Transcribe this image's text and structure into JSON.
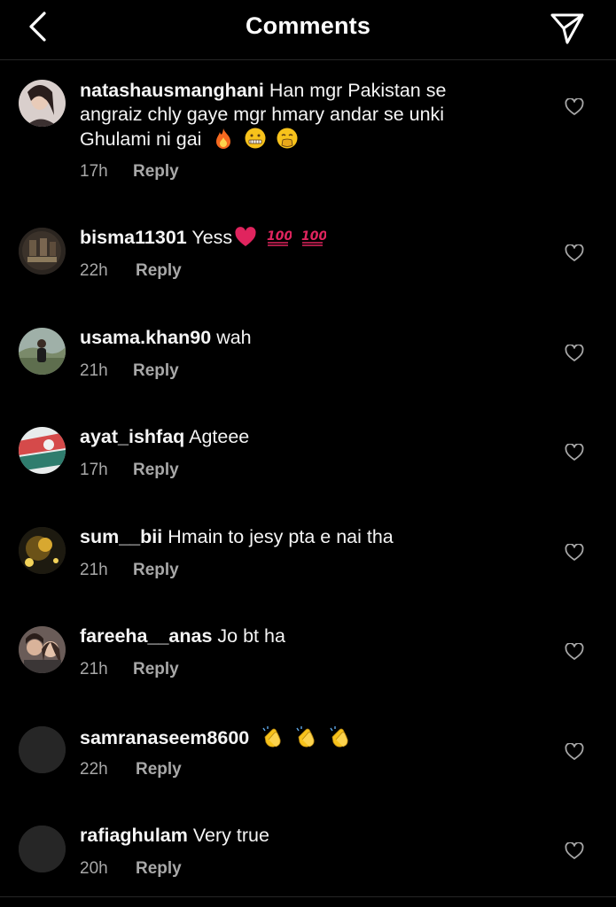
{
  "header": {
    "title": "Comments",
    "back_icon": "chevron-left-icon",
    "share_icon": "paper-plane-icon"
  },
  "colors": {
    "background": "#000000",
    "text": "#f5f5f5",
    "muted": "#a8a8a8",
    "divider": "#262626",
    "heart_red": "#e0245e",
    "hundred_red": "#e0245e",
    "fire_orange": "#f5691f",
    "emoji_yellow": "#f7c21b"
  },
  "comments": [
    {
      "username": "natashausmanghani",
      "text_lines": [
        "Han mgr Pakistan se",
        "angraiz chly gaye mgr hmary andar se unki",
        "Ghulami ni gai"
      ],
      "emojis": [
        "fire",
        "zipper-mouth-face",
        "face-with-hand-over-mouth"
      ],
      "time": "17h",
      "reply": "Reply",
      "avatar": "avatar-photo-woman"
    },
    {
      "username": "bisma11301",
      "text": "Yess",
      "emojis": [
        "red-heart",
        "hundred-points",
        "hundred-points"
      ],
      "time": "22h",
      "reply": "Reply",
      "avatar": "avatar-photo-group"
    },
    {
      "username": "usama.khan90",
      "text": "wah",
      "emojis": [],
      "time": "21h",
      "reply": "Reply",
      "avatar": "avatar-photo-outdoor"
    },
    {
      "username": "ayat_ishfaq",
      "text": "Agteee",
      "emojis": [],
      "time": "17h",
      "reply": "Reply",
      "avatar": "avatar-photo-flag"
    },
    {
      "username": "sum__bii",
      "text": "Hmain to jesy pta e nai tha",
      "emojis": [],
      "time": "21h",
      "reply": "Reply",
      "avatar": "avatar-photo-night"
    },
    {
      "username": "fareeha__anas",
      "text": "Jo bt ha",
      "emojis": [],
      "time": "21h",
      "reply": "Reply",
      "avatar": "avatar-photo-couple"
    },
    {
      "username": "samranaseem8600",
      "text": "",
      "emojis": [
        "clapping-hands",
        "clapping-hands",
        "clapping-hands"
      ],
      "time": "22h",
      "reply": "Reply",
      "avatar": "avatar-placeholder"
    },
    {
      "username": "rafiaghulam",
      "text": "Very true",
      "emojis": [],
      "time": "20h",
      "reply": "Reply",
      "avatar": "avatar-placeholder"
    }
  ]
}
